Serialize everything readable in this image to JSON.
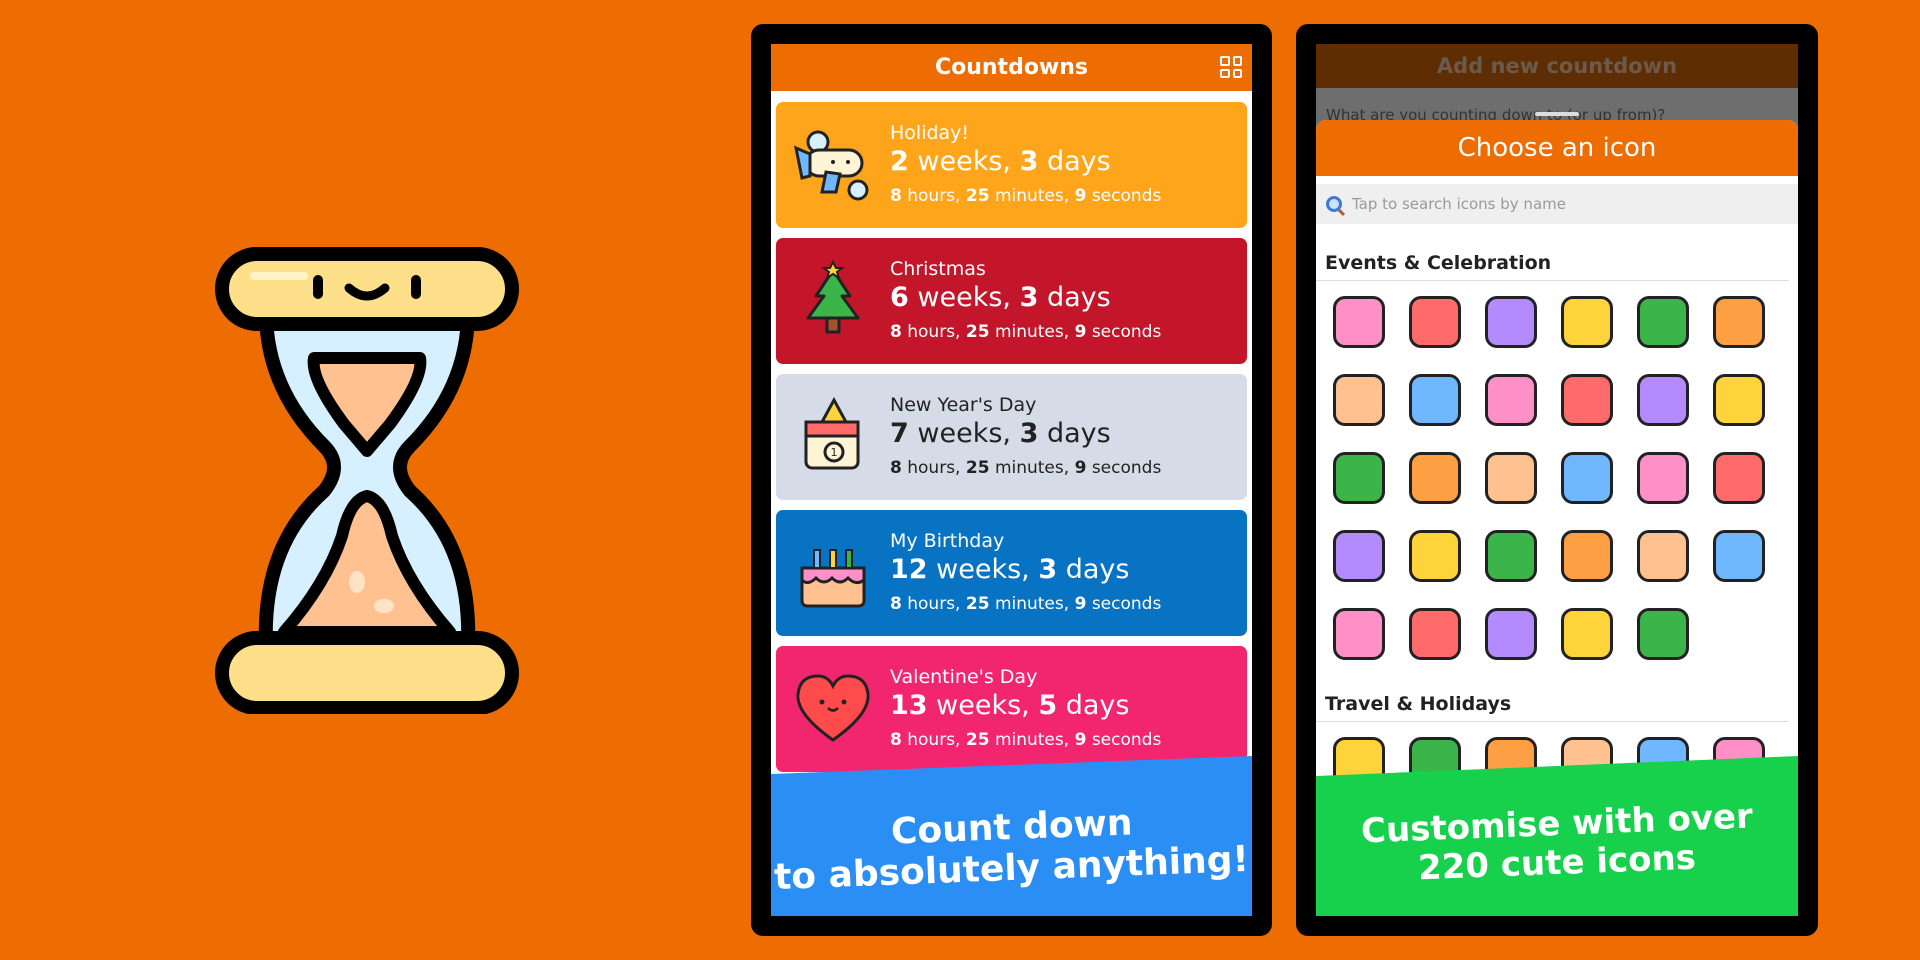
{
  "colors": {
    "background": "#EE6D02",
    "accent": "#EE6D02",
    "banner_blue": "#2B8EF5",
    "banner_green": "#17D14D"
  },
  "logo": {
    "icon": "hourglass-icon"
  },
  "countdowns_screen": {
    "title": "Countdowns",
    "grid_icon": "grid-view-icon",
    "cards": [
      {
        "icon": "airplane-icon",
        "title": "Holiday!",
        "weeks": "2",
        "days": "3",
        "hours": "8",
        "minutes": "25",
        "seconds": "9",
        "color": "#FFA51B"
      },
      {
        "icon": "christmas-tree-icon",
        "title": "Christmas",
        "weeks": "6",
        "days": "3",
        "hours": "8",
        "minutes": "25",
        "seconds": "9",
        "color": "#C4162A"
      },
      {
        "icon": "new-year-calendar-icon",
        "title": "New Year's Day",
        "weeks": "7",
        "days": "3",
        "hours": "8",
        "minutes": "25",
        "seconds": "9",
        "color": "#D6DCE7"
      },
      {
        "icon": "birthday-cake-icon",
        "title": "My Birthday",
        "weeks": "12",
        "days": "3",
        "hours": "8",
        "minutes": "25",
        "seconds": "9",
        "color": "#0872C3"
      },
      {
        "icon": "heart-icon",
        "title": "Valentine's Day",
        "weeks": "13",
        "days": "5",
        "hours": "8",
        "minutes": "25",
        "seconds": "9",
        "color": "#F2266F"
      }
    ],
    "units": {
      "weeks": "weeks,",
      "days": "days",
      "hours": "hours,",
      "minutes": "minutes,",
      "seconds": "seconds"
    },
    "banner": {
      "line1": "Count down",
      "line2": "to absolutely anything!"
    }
  },
  "icon_screen": {
    "behind_title": "Add new countdown",
    "behind_question": "What are you counting down to (or up from)?",
    "sheet_title": "Choose an icon",
    "search_placeholder": "Tap to search icons by name",
    "sections": [
      {
        "title": "Events & Celebration",
        "icons": [
          "wedding-cake-icon",
          "ring-icon",
          "birthday-cake-icon",
          "new-year-calendar-icon",
          "gift-basket-icon",
          "easter-egg-icon",
          "uncle-sam-hat-icon",
          "pumpkin-icon",
          "roast-turkey-icon",
          "christmas-tree-icon",
          "diya-lamp-icon",
          "dreidel-icon",
          "church-icon",
          "baby-mobile-icon",
          "abc-blocks-icon",
          "baby-bottle-icon",
          "rainbow-heart-icon",
          "rainbow-flag-icon",
          "key-icon",
          "fireworks-icon",
          "gift-icon",
          "heart-icon",
          "bouquet-icon",
          "love-letter-icon",
          "invitation-envelope-icon",
          "party-popper-icon",
          "balloons-icon",
          "graduation-cap-icon",
          "bells-icon"
        ]
      },
      {
        "title": "Travel & Holidays",
        "icons": [
          "airplane-icon",
          "train-icon",
          "camper-van-icon",
          "cruise-ship-icon",
          "sailboat-icon",
          "suitcase-icon"
        ]
      }
    ],
    "banner": {
      "line1": "Customise with over",
      "line2": "220 cute icons"
    }
  }
}
